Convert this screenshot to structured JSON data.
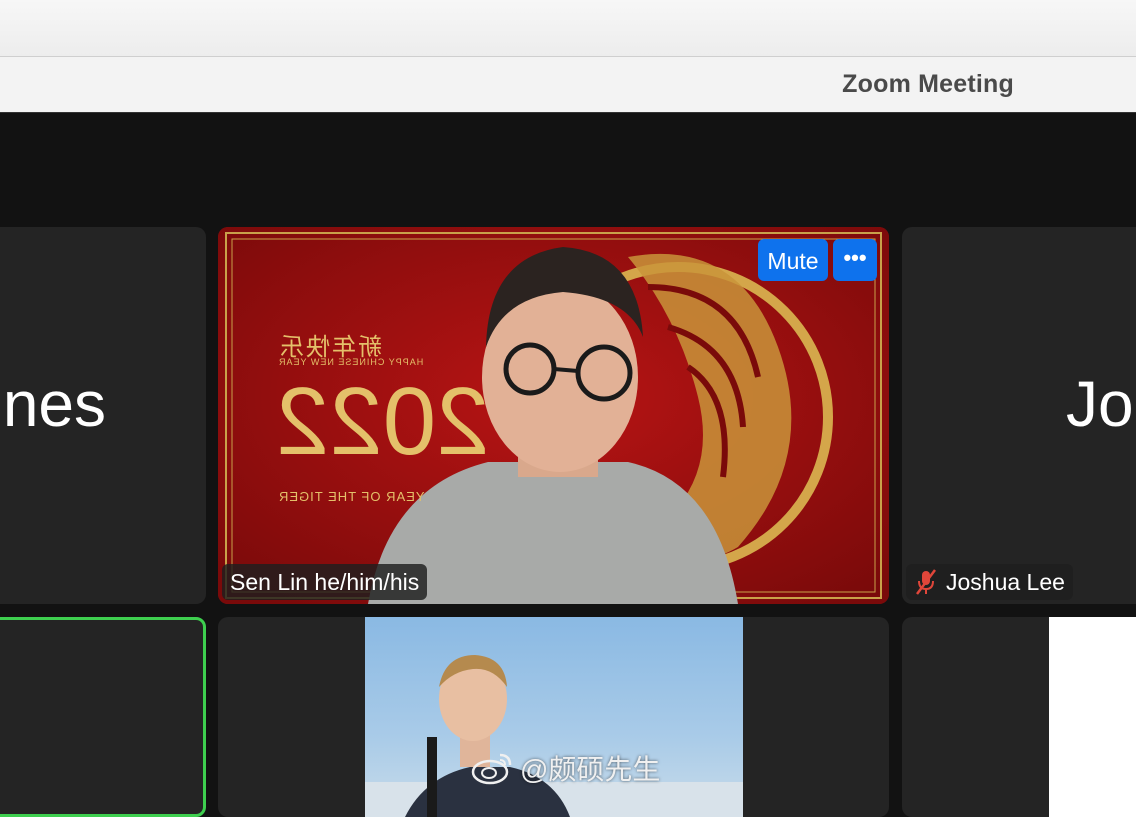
{
  "window": {
    "title": "Zoom Meeting"
  },
  "participants": [
    {
      "tile": "left-top",
      "name_fragment": "nes"
    },
    {
      "tile": "center-top",
      "name": "Sen Lin he/him/his",
      "mute_label": "Mute",
      "more_label": "•••",
      "background_text": [
        "新年快乐",
        "HAPPY CHINESE NEW YEAR",
        "2022",
        "YEAR OF THE TIGER"
      ]
    },
    {
      "tile": "right-top",
      "name_fragment": "Jo",
      "name": "Joshua Lee",
      "muted": true
    }
  ],
  "watermark": {
    "text": "@颇硕先生"
  },
  "colors": {
    "accent": "#0e72ed",
    "active_speaker": "#3ecf4f",
    "tile_bg": "#242424",
    "stage_bg": "#121212"
  }
}
